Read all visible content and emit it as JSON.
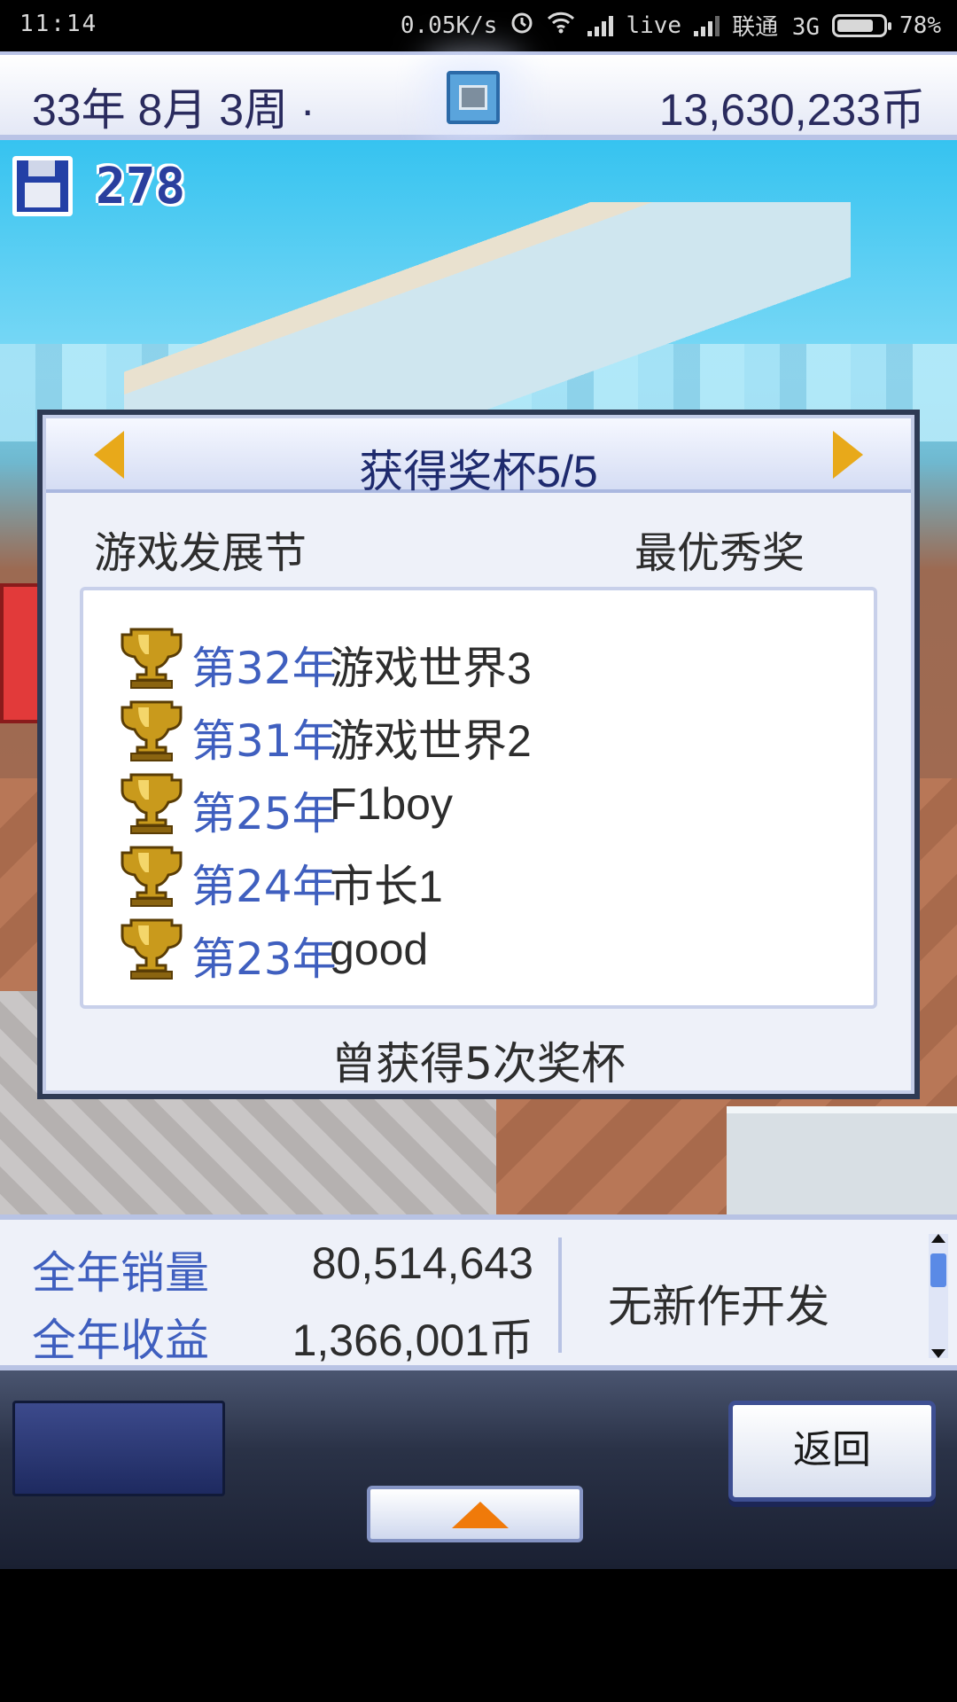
{
  "status_bar": {
    "time": "11:14",
    "net_speed": "0.05K/s",
    "carrier_label": "live",
    "carrier": "联通 3G",
    "battery": "78%"
  },
  "top_bar": {
    "date": "33年 8月 3周 ·",
    "money": "13,630,233币",
    "camera_icon": "camera-icon"
  },
  "save": {
    "count": "278",
    "icon": "floppy-disk-icon"
  },
  "dialog": {
    "title": "获得奖杯5/5",
    "event": "游戏发展节",
    "award": "最优秀奖",
    "trophies": [
      {
        "year": "第32年",
        "game": "游戏世界3"
      },
      {
        "year": "第31年",
        "game": "游戏世界2"
      },
      {
        "year": "第25年",
        "game": "F1boy"
      },
      {
        "year": "第24年",
        "game": "市长1"
      },
      {
        "year": "第23年",
        "game": "good"
      }
    ],
    "summary": "曾获得5次奖杯"
  },
  "info_bar": {
    "sales_label": "全年销量",
    "sales_value": "80,514,643",
    "revenue_label": "全年收益",
    "revenue_value": "1,366,001币",
    "dev_status": "无新作开发"
  },
  "controls": {
    "back_label": "返回"
  },
  "colors": {
    "accent_blue": "#3f5fbf",
    "title_navy": "#1e2a6e",
    "arrow_gold": "#e8a91a",
    "up_arrow_orange": "#f07a0a"
  }
}
